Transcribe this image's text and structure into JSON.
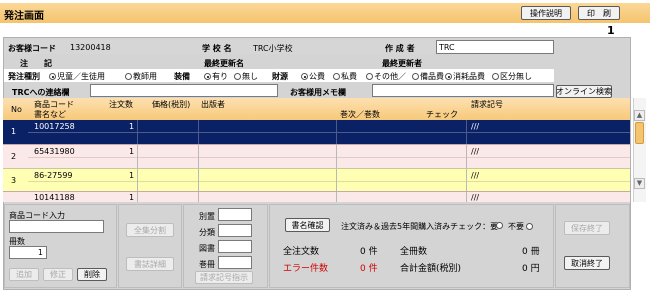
{
  "header": {
    "title": "発注画面",
    "manual_label": "操作説明",
    "print_label": "印　刷",
    "page_number": "1"
  },
  "info": {
    "customer_code_label": "お客様コード",
    "customer_code": "13200418",
    "school_label": "学 校 名",
    "school_name": "TRC小学校",
    "creator_label": "作 成 者",
    "creator": "TRC",
    "note_label": "注　　記",
    "last_updater_label": "最終更新名",
    "last_updater2_label": "最終更新者"
  },
  "order_options": {
    "type_label": "発注種別",
    "type_options": [
      "児童／生徒用",
      "教師用"
    ],
    "equip_label": "装備",
    "equip_options": [
      "有り",
      "無し"
    ],
    "fund_label": "財源",
    "fund_options": [
      "公費",
      "私費",
      "その他／",
      "備品費",
      "消耗品費",
      "区分無し"
    ],
    "trc_memo_label": "TRCへの連絡欄",
    "customer_memo_label": "お客様用メモ欄",
    "online_search_label": "オンライン検索"
  },
  "table": {
    "headers": {
      "no": "No",
      "code": "商品コード",
      "title": "書名など",
      "qty": "注文数",
      "price": "価格(税別)",
      "publisher": "出版者",
      "volume": "巻次／巻数",
      "check": "チェック",
      "shelf": "請求記号"
    },
    "rows": [
      {
        "no": "1",
        "code": "10017258",
        "qty": "1",
        "shelf": "///"
      },
      {
        "no": "2",
        "code": "65431980",
        "qty": "1",
        "shelf": "///"
      },
      {
        "no": "3",
        "code": "86-27599",
        "qty": "1",
        "shelf": "///"
      },
      {
        "no": "",
        "code": "10141188",
        "qty": "1",
        "shelf": "///"
      }
    ]
  },
  "bottom": {
    "code_input_label": "商品コード入力",
    "qty_label": "冊数",
    "qty_value": "1",
    "add_label": "追加",
    "modify_label": "修正",
    "delete_label": "削除",
    "split_label": "全集分割",
    "detail_label": "書誌詳細",
    "field1_label": "別置",
    "field2_label": "分類",
    "field3_label": "図書",
    "field4_label": "巻冊",
    "shelf_instruct_label": "請求記号指示",
    "confirm_label": "書名確認",
    "check_text": "注文済み＆過去5年間購入済みチェック：要",
    "not_needed_label": "不要",
    "total_orders_label": "全注文数",
    "total_orders_value": "0 件",
    "error_label": "エラー件数",
    "error_value": "0 件",
    "total_books_label": "全冊数",
    "total_books_value": "0 冊",
    "total_amount_label": "合計金額(税別)",
    "total_amount_value": "0 円",
    "save_exit_label": "保存終了",
    "cancel_exit_label": "取消終了"
  },
  "colors": {
    "accent": "#f7c97a",
    "selected": "#0a2265",
    "row_pink": "#fbe9e9",
    "row_yellow": "#ffffb4",
    "panel": "#d4d4d4"
  }
}
